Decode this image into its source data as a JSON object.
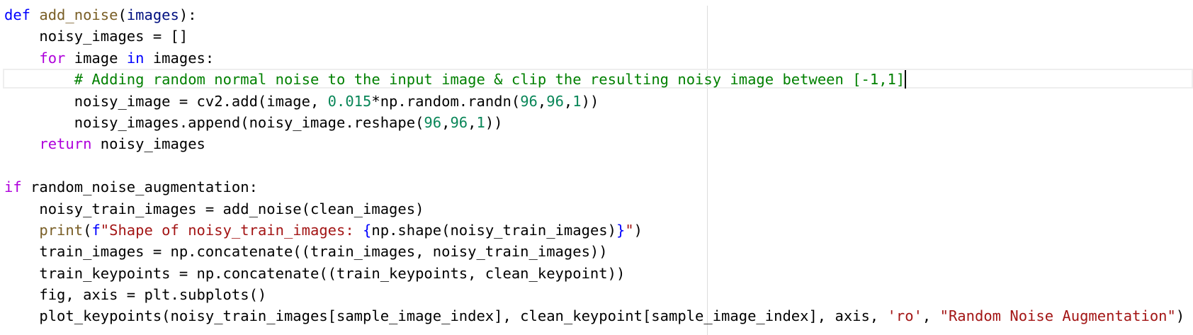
{
  "editor": {
    "lines": [
      {
        "tokens": [
          {
            "t": "def",
            "c": "kw"
          },
          {
            "t": " "
          },
          {
            "t": "add_noise",
            "c": "fn"
          },
          {
            "t": "("
          },
          {
            "t": "images",
            "c": "var"
          },
          {
            "t": "):"
          }
        ]
      },
      {
        "tokens": [
          {
            "t": "    noisy_images = []"
          }
        ]
      },
      {
        "tokens": [
          {
            "t": "    "
          },
          {
            "t": "for",
            "c": "kw2"
          },
          {
            "t": " image "
          },
          {
            "t": "in",
            "c": "kw"
          },
          {
            "t": " images:"
          }
        ]
      },
      {
        "current": true,
        "cursor": true,
        "tokens": [
          {
            "t": "        "
          },
          {
            "t": "# Adding random normal noise to the input image & clip the resulting noisy image between [-1,1]",
            "c": "cmt"
          }
        ]
      },
      {
        "tokens": [
          {
            "t": "        noisy_image = cv2.add(image, "
          },
          {
            "t": "0.015",
            "c": "num"
          },
          {
            "t": "*np.random.randn("
          },
          {
            "t": "96",
            "c": "num"
          },
          {
            "t": ","
          },
          {
            "t": "96",
            "c": "num"
          },
          {
            "t": ","
          },
          {
            "t": "1",
            "c": "num"
          },
          {
            "t": "))"
          }
        ]
      },
      {
        "tokens": [
          {
            "t": "        noisy_images.append(noisy_image.reshape("
          },
          {
            "t": "96",
            "c": "num"
          },
          {
            "t": ","
          },
          {
            "t": "96",
            "c": "num"
          },
          {
            "t": ","
          },
          {
            "t": "1",
            "c": "num"
          },
          {
            "t": "))"
          }
        ]
      },
      {
        "tokens": [
          {
            "t": "    "
          },
          {
            "t": "return",
            "c": "kw2"
          },
          {
            "t": " noisy_images"
          }
        ]
      },
      {
        "tokens": [
          {
            "t": ""
          }
        ]
      },
      {
        "tokens": [
          {
            "t": "if",
            "c": "kw2"
          },
          {
            "t": " random_noise_augmentation:"
          }
        ]
      },
      {
        "tokens": [
          {
            "t": "    noisy_train_images = add_noise(clean_images)"
          }
        ]
      },
      {
        "tokens": [
          {
            "t": "    "
          },
          {
            "t": "print",
            "c": "fn"
          },
          {
            "t": "("
          },
          {
            "t": "f",
            "c": "kw"
          },
          {
            "t": "\"Shape of noisy_train_images: ",
            "c": "str"
          },
          {
            "t": "{",
            "c": "kw"
          },
          {
            "t": "np.shape(noisy_train_images)"
          },
          {
            "t": "}",
            "c": "kw"
          },
          {
            "t": "\"",
            "c": "str"
          },
          {
            "t": ")"
          }
        ]
      },
      {
        "tokens": [
          {
            "t": "    train_images = np.concatenate((train_images, noisy_train_images))"
          }
        ]
      },
      {
        "tokens": [
          {
            "t": "    train_keypoints = np.concatenate((train_keypoints, clean_keypoint))"
          }
        ]
      },
      {
        "tokens": [
          {
            "t": "    fig, axis = plt.subplots()"
          }
        ]
      },
      {
        "tokens": [
          {
            "t": "    plot_keypoints(noisy_train_images[sample_image_index], clean_keypoint[sample_image_index], axis, "
          },
          {
            "t": "'ro'",
            "c": "str"
          },
          {
            "t": ", "
          },
          {
            "t": "\"Random Noise Augmentation\"",
            "c": "str"
          },
          {
            "t": ")"
          }
        ]
      }
    ]
  }
}
